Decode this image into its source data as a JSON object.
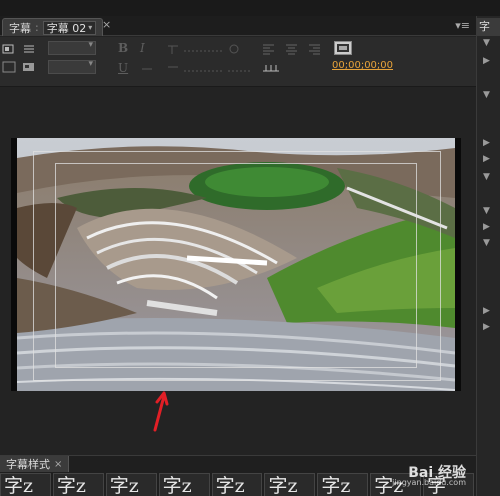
{
  "title_tab": {
    "label": "字幕",
    "selected": "字幕 02"
  },
  "toolbar": {
    "timecode": "00;00;00;00"
  },
  "right_panel": {
    "tab_label": "字"
  },
  "bottom_panel": {
    "tab_label": "字幕样式",
    "styles": [
      "字z",
      "字z",
      "字z",
      "字z",
      "字z",
      "字z",
      "字z",
      "字z",
      "字"
    ]
  },
  "watermark": {
    "brand": "Bai 经验",
    "sub": "jingyan.baidu.com"
  },
  "colors": {
    "accent": "#e8a33a",
    "arrow": "#e21f26",
    "panel": "#2b2b2b"
  },
  "icons": [
    "menu-icon",
    "close-icon",
    "caret-down-icon",
    "align-left-icon",
    "align-center-icon",
    "align-right-icon",
    "film-icon",
    "up-arrow-annotation"
  ]
}
